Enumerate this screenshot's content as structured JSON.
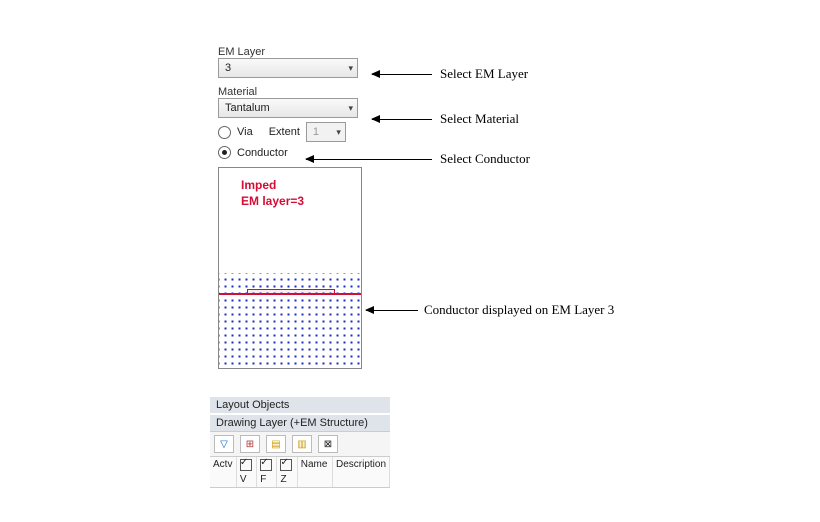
{
  "panel": {
    "em_layer_label": "EM Layer",
    "em_layer_value": "3",
    "material_label": "Material",
    "material_value": "Tantalum",
    "via_label": "Via",
    "extent_label": "Extent",
    "extent_value": "1",
    "conductor_label": "Conductor"
  },
  "canvas": {
    "line1": "Imped",
    "line2": "EM layer=3"
  },
  "layout": {
    "title1": "Layout Objects",
    "title2": "Drawing Layer (+EM Structure)",
    "cols": {
      "actv": "Actv",
      "v": "V",
      "f": "F",
      "z": "Z",
      "name": "Name",
      "desc": "Description"
    }
  },
  "annotations": {
    "a1": "Select EM Layer",
    "a2": "Select Material",
    "a3": "Select Conductor",
    "a4": "Conductor displayed on EM Layer 3"
  }
}
